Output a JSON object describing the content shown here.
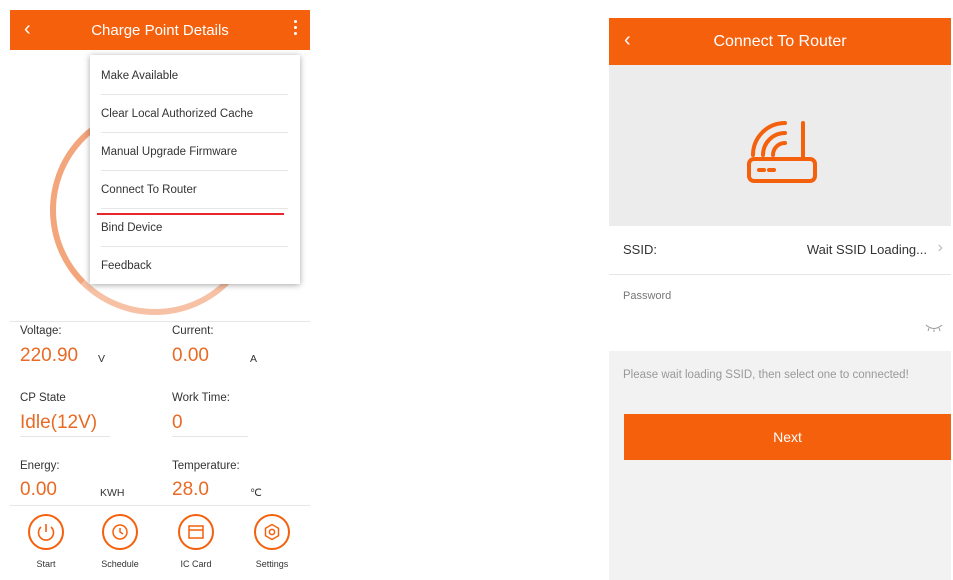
{
  "left": {
    "header": {
      "title": "Charge Point Details"
    },
    "menu": {
      "items": [
        "Make Available",
        "Clear Local Authorized Cache",
        "Manual Upgrade Firmware",
        "Connect To Router",
        "Bind Device",
        "Feedback"
      ]
    },
    "stats": {
      "voltage": {
        "label": "Voltage:",
        "value": "220.90",
        "unit": "V"
      },
      "current": {
        "label": "Current:",
        "value": "0.00",
        "unit": "A"
      },
      "cp_state": {
        "label": "CP State",
        "value": "Idle(12V)"
      },
      "work_time": {
        "label": "Work Time:",
        "value": "0"
      },
      "energy": {
        "label": "Energy:",
        "value": "0.00",
        "unit": "KWH"
      },
      "temperature": {
        "label": "Temperature:",
        "value": "28.0",
        "unit": "℃"
      }
    },
    "tabs": [
      "Start",
      "Schedule",
      "IC Card",
      "Settings"
    ]
  },
  "right": {
    "header": {
      "title": "Connect To Router"
    },
    "ssid": {
      "label": "SSID:",
      "value": "Wait SSID Loading..."
    },
    "password": {
      "label": "Password"
    },
    "hint": "Please wait loading SSID, then select one to connected!",
    "next_label": "Next"
  },
  "colors": {
    "accent": "#f5600c",
    "value": "#e96a24"
  }
}
